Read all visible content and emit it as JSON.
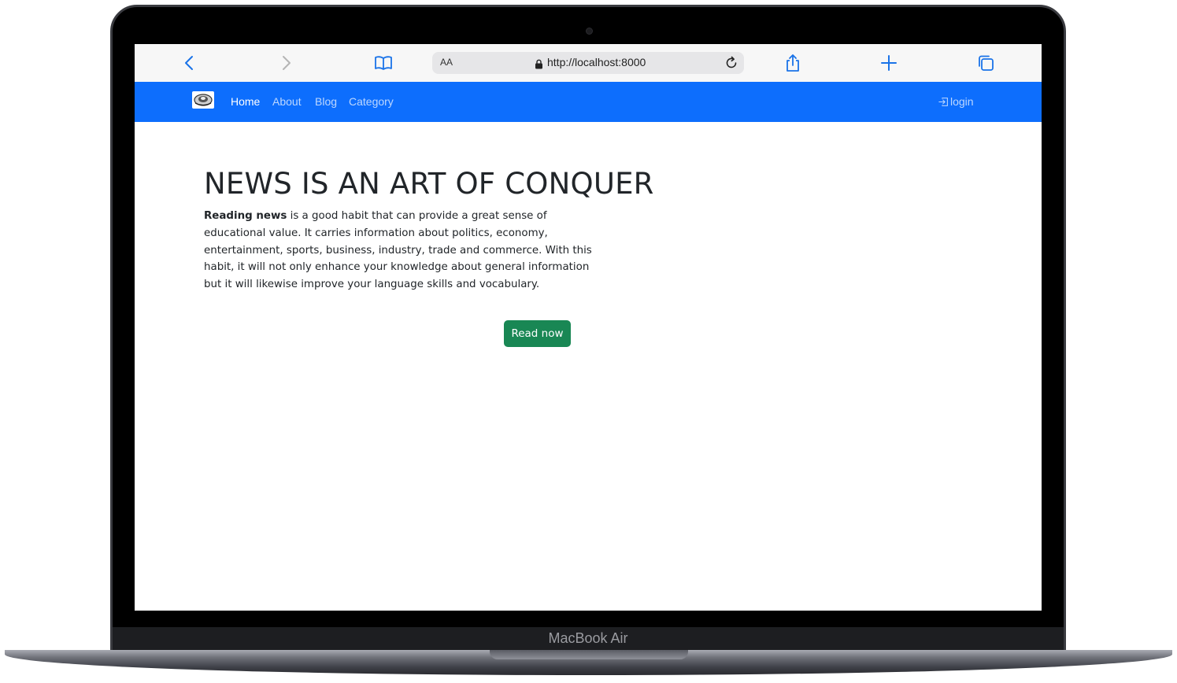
{
  "device": {
    "label": "MacBook Air"
  },
  "browser": {
    "aa_label": "AA",
    "url": "http://localhost:8000",
    "icons": [
      "chevron-left-icon",
      "chevron-right-icon",
      "book-icon",
      "lock-icon",
      "reload-icon",
      "share-icon",
      "plus-icon",
      "tabs-icon"
    ],
    "accent_color": "#1a73e8"
  },
  "navbar": {
    "background": "#0d6efd",
    "items": [
      {
        "label": "Home",
        "active": true
      },
      {
        "label": "About",
        "active": false
      },
      {
        "label": "Blog",
        "active": false
      },
      {
        "label": "Category",
        "active": false
      }
    ],
    "login_label": "login",
    "login_icon": "box-arrow-in-right-icon"
  },
  "hero": {
    "title": "NEWS IS AN ART OF CONQUER",
    "lead_bold": "Reading news",
    "body": " is a good habit that can provide a great sense of educational value. It carries information about politics, economy, entertainment, sports, business, industry, trade and commerce. With this habit, it will not only enhance your knowledge about general information but it will likewise improve your language skills and vocabulary.",
    "button_label": "Read now",
    "button_color": "#198754"
  }
}
